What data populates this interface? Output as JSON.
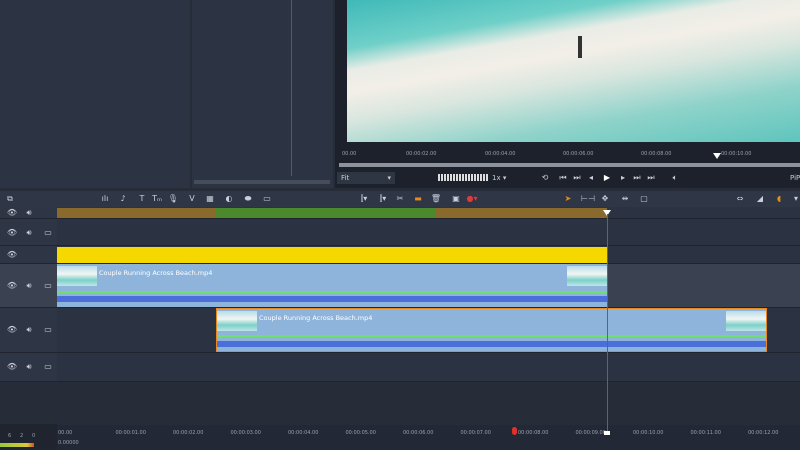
{
  "preview": {
    "ruler": [
      "00.00",
      "00:00:02.00",
      "00:00:04.00",
      "00:00:06.00",
      "00:00:08.00",
      "00:00:10.00"
    ],
    "fit_label": "Fit",
    "speed_label": "1x",
    "pip_label": "PiP"
  },
  "toolbar": {
    "icons": [
      "storyboard-icon",
      "audio-mixer-icon",
      "clean-audio-icon",
      "title-icon",
      "title-editor-icon",
      "voiceover-icon",
      "transition-icon",
      "grid-icon",
      "color-icon",
      "link-icon",
      "subtitle-icon"
    ]
  },
  "timeline": {
    "clips": [
      {
        "name": "Couple Running Across Beach.mp4"
      },
      {
        "name": "Couple Running Across Beach.mp4"
      }
    ],
    "ruler": [
      "00.00",
      "00:00:01.00",
      "00:00:02.00",
      "00:00:03.00",
      "00:00:04.00",
      "00:00:05.00",
      "00:00:06.00",
      "00:00:07.00",
      "00:00:08.00",
      "00:00:09.00",
      "00:00:10.00",
      "00:00:11.00",
      "00:00:12.00"
    ],
    "meter_labels": [
      "6",
      "2",
      "0"
    ],
    "position": "0.00000"
  },
  "colors": {
    "playhead": "#e0302a",
    "title_track": "#f5d800",
    "clip": "#8fb4dc",
    "selected": "#e88a1e"
  }
}
